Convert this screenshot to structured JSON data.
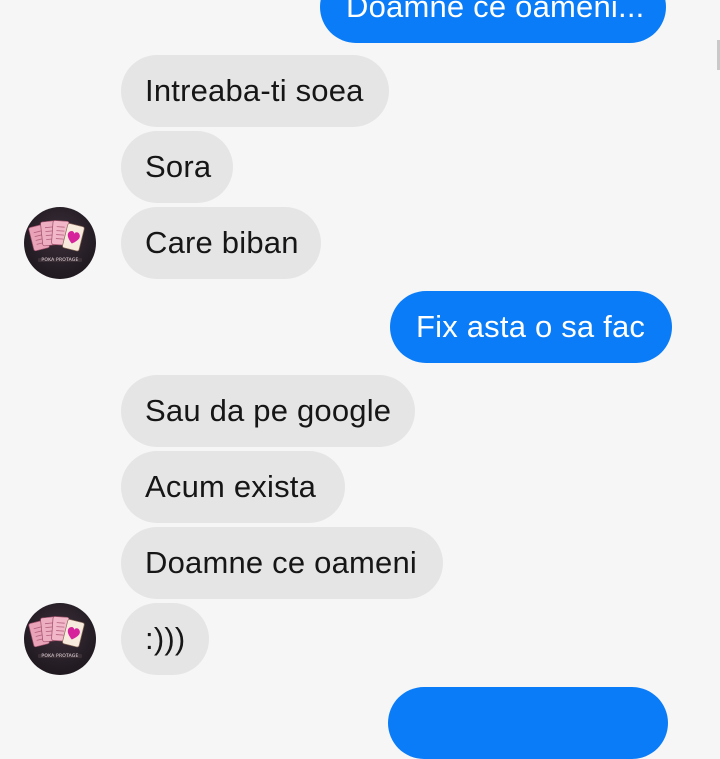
{
  "conversation": {
    "messages": [
      {
        "side": "outgoing",
        "text": "Doamne ce oameni..."
      },
      {
        "side": "incoming",
        "text": "Intreaba-ti soea"
      },
      {
        "side": "incoming",
        "text": "Sora"
      },
      {
        "side": "incoming",
        "text": "Care biban"
      },
      {
        "side": "outgoing",
        "text": "Fix asta o sa fac"
      },
      {
        "side": "incoming",
        "text": "Sau da pe google"
      },
      {
        "side": "incoming",
        "text": "Acum exista"
      },
      {
        "side": "incoming",
        "text": "Doamne ce oameni"
      },
      {
        "side": "incoming",
        "text": ":)))"
      },
      {
        "side": "outgoing",
        "text": ""
      }
    ]
  },
  "contact": {
    "avatar_icon": "playing-cards-avatar-icon",
    "avatar_caption": "POKA PROTAGE"
  },
  "colors": {
    "outgoing_bubble": "#0a7cf7",
    "incoming_bubble": "#e5e5e6",
    "background": "#f6f6f6",
    "avatar_heart": "#d6239b"
  }
}
